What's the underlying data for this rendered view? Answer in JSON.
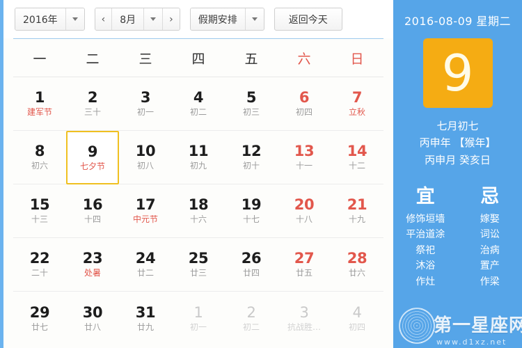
{
  "toolbar": {
    "year_label": "2016年",
    "year_caret": "chevron-down-icon",
    "prev_month": "‹",
    "month_label": "8月",
    "month_caret": "chevron-down-icon",
    "next_month": "›",
    "holiday_label": "假期安排",
    "holiday_caret": "chevron-down-icon",
    "today_label": "返回今天"
  },
  "weekdays": [
    {
      "label": "一",
      "weekend": false
    },
    {
      "label": "二",
      "weekend": false
    },
    {
      "label": "三",
      "weekend": false
    },
    {
      "label": "四",
      "weekend": false
    },
    {
      "label": "五",
      "weekend": false
    },
    {
      "label": "六",
      "weekend": true
    },
    {
      "label": "日",
      "weekend": true
    }
  ],
  "days": [
    {
      "num": "1",
      "sub": "建军节",
      "festival": true,
      "weekend": false,
      "other": false,
      "selected": false
    },
    {
      "num": "2",
      "sub": "三十",
      "festival": false,
      "weekend": false,
      "other": false,
      "selected": false
    },
    {
      "num": "3",
      "sub": "初一",
      "festival": false,
      "weekend": false,
      "other": false,
      "selected": false
    },
    {
      "num": "4",
      "sub": "初二",
      "festival": false,
      "weekend": false,
      "other": false,
      "selected": false
    },
    {
      "num": "5",
      "sub": "初三",
      "festival": false,
      "weekend": false,
      "other": false,
      "selected": false
    },
    {
      "num": "6",
      "sub": "初四",
      "festival": false,
      "weekend": true,
      "other": false,
      "selected": false
    },
    {
      "num": "7",
      "sub": "立秋",
      "festival": true,
      "weekend": true,
      "other": false,
      "selected": false
    },
    {
      "num": "8",
      "sub": "初六",
      "festival": false,
      "weekend": false,
      "other": false,
      "selected": false
    },
    {
      "num": "9",
      "sub": "七夕节",
      "festival": true,
      "weekend": false,
      "other": false,
      "selected": true
    },
    {
      "num": "10",
      "sub": "初八",
      "festival": false,
      "weekend": false,
      "other": false,
      "selected": false
    },
    {
      "num": "11",
      "sub": "初九",
      "festival": false,
      "weekend": false,
      "other": false,
      "selected": false
    },
    {
      "num": "12",
      "sub": "初十",
      "festival": false,
      "weekend": false,
      "other": false,
      "selected": false
    },
    {
      "num": "13",
      "sub": "十一",
      "festival": false,
      "weekend": true,
      "other": false,
      "selected": false
    },
    {
      "num": "14",
      "sub": "十二",
      "festival": false,
      "weekend": true,
      "other": false,
      "selected": false
    },
    {
      "num": "15",
      "sub": "十三",
      "festival": false,
      "weekend": false,
      "other": false,
      "selected": false
    },
    {
      "num": "16",
      "sub": "十四",
      "festival": false,
      "weekend": false,
      "other": false,
      "selected": false
    },
    {
      "num": "17",
      "sub": "中元节",
      "festival": true,
      "weekend": false,
      "other": false,
      "selected": false
    },
    {
      "num": "18",
      "sub": "十六",
      "festival": false,
      "weekend": false,
      "other": false,
      "selected": false
    },
    {
      "num": "19",
      "sub": "十七",
      "festival": false,
      "weekend": false,
      "other": false,
      "selected": false
    },
    {
      "num": "20",
      "sub": "十八",
      "festival": false,
      "weekend": true,
      "other": false,
      "selected": false
    },
    {
      "num": "21",
      "sub": "十九",
      "festival": false,
      "weekend": true,
      "other": false,
      "selected": false
    },
    {
      "num": "22",
      "sub": "二十",
      "festival": false,
      "weekend": false,
      "other": false,
      "selected": false
    },
    {
      "num": "23",
      "sub": "处暑",
      "festival": true,
      "weekend": false,
      "other": false,
      "selected": false
    },
    {
      "num": "24",
      "sub": "廿二",
      "festival": false,
      "weekend": false,
      "other": false,
      "selected": false
    },
    {
      "num": "25",
      "sub": "廿三",
      "festival": false,
      "weekend": false,
      "other": false,
      "selected": false
    },
    {
      "num": "26",
      "sub": "廿四",
      "festival": false,
      "weekend": false,
      "other": false,
      "selected": false
    },
    {
      "num": "27",
      "sub": "廿五",
      "festival": false,
      "weekend": true,
      "other": false,
      "selected": false
    },
    {
      "num": "28",
      "sub": "廿六",
      "festival": false,
      "weekend": true,
      "other": false,
      "selected": false
    },
    {
      "num": "29",
      "sub": "廿七",
      "festival": false,
      "weekend": false,
      "other": false,
      "selected": false
    },
    {
      "num": "30",
      "sub": "廿八",
      "festival": false,
      "weekend": false,
      "other": false,
      "selected": false
    },
    {
      "num": "31",
      "sub": "廿九",
      "festival": false,
      "weekend": false,
      "other": false,
      "selected": false
    },
    {
      "num": "1",
      "sub": "初一",
      "festival": false,
      "weekend": false,
      "other": true,
      "selected": false
    },
    {
      "num": "2",
      "sub": "初二",
      "festival": false,
      "weekend": false,
      "other": true,
      "selected": false
    },
    {
      "num": "3",
      "sub": "抗战胜…",
      "festival": false,
      "weekend": true,
      "other": true,
      "selected": false
    },
    {
      "num": "4",
      "sub": "初四",
      "festival": false,
      "weekend": true,
      "other": true,
      "selected": false
    }
  ],
  "side": {
    "date_line": "2016-08-09 星期二",
    "big_day": "9",
    "lunar_day": "七月初七",
    "ganzhi_year": "丙申年 【猴年】",
    "ganzhi_month_day": "丙申月 癸亥日",
    "yi_head": "宜",
    "ji_head": "忌",
    "yi_items": [
      "修饰垣墙",
      "平治道涂",
      "祭祀",
      "沐浴",
      "作灶"
    ],
    "ji_items": [
      "嫁娶",
      "词讼",
      "治病",
      "置产",
      "作梁"
    ]
  },
  "watermark": {
    "text": "第一星座网",
    "url": "www.d1xz.net"
  },
  "colors": {
    "panel_blue": "#56a5e8",
    "accent_yellow": "#f5ac13",
    "selected_border": "#f0c020",
    "festival_red": "#e2574c"
  }
}
